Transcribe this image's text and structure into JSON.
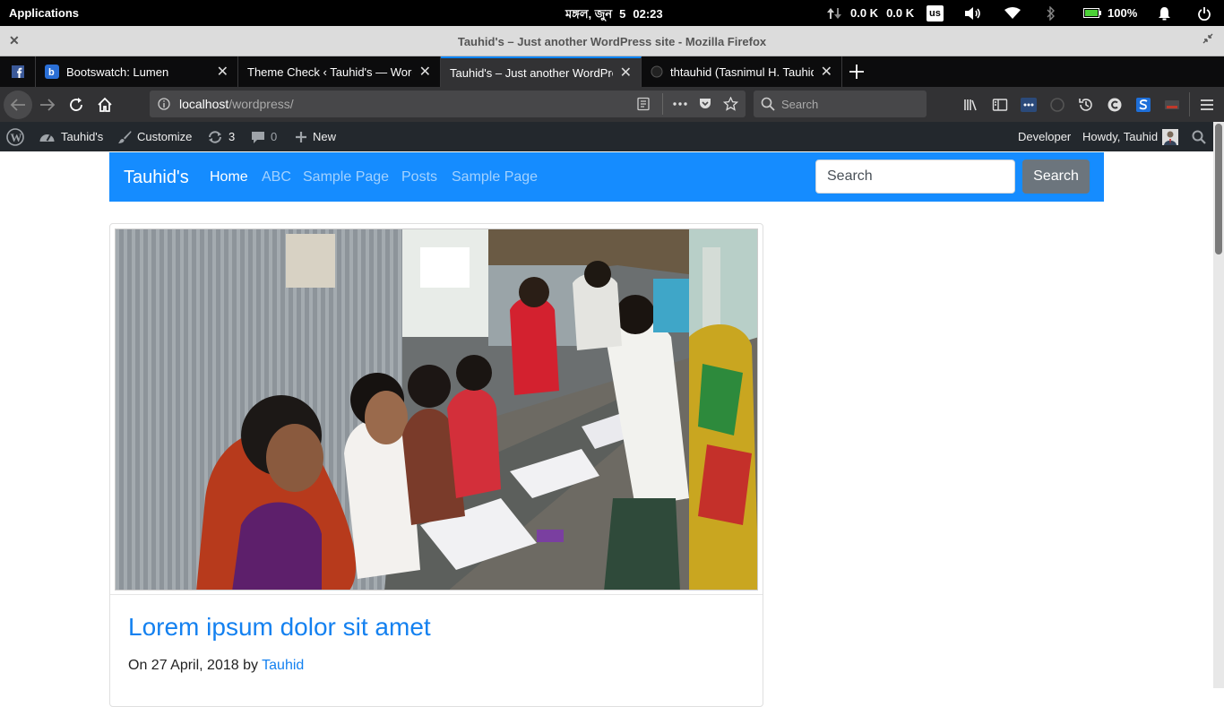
{
  "topbar": {
    "applications": "Applications",
    "date": "মঙ্গল, জুন",
    "day": "5",
    "time": "02:23",
    "net_up": "0.0 K",
    "net_down": "0.0 K",
    "keyboard": "us",
    "battery": "100%"
  },
  "window": {
    "title": "Tauhid's – Just another WordPress site - Mozilla Firefox"
  },
  "tabs": [
    {
      "label": "Bootswatch: Lumen",
      "icon": "bootswatch-icon"
    },
    {
      "label": "Theme Check ‹ Tauhid's — WordPress",
      "icon": "wordpress-icon"
    },
    {
      "label": "Tauhid's – Just another WordPress site",
      "icon": "page-icon",
      "active": true
    },
    {
      "label": "thtauhid (Tasnimul H. Tauhid)",
      "icon": "github-icon"
    }
  ],
  "navbar": {
    "url_host": "localhost",
    "url_path": "/wordpress/",
    "search_placeholder": "Search"
  },
  "wpbar": {
    "site": "Tauhid's",
    "customize": "Customize",
    "updates": "3",
    "comments": "0",
    "new": "New",
    "developer": "Developer",
    "howdy": "Howdy, Tauhid"
  },
  "site": {
    "brand": "Tauhid's",
    "nav": [
      "Home",
      "ABC",
      "Sample Page",
      "Posts",
      "Sample Page"
    ],
    "search_placeholder": "Search",
    "search_button": "Search"
  },
  "post": {
    "title": "Lorem ipsum dolor sit amet",
    "meta_prefix": "On 27 April, 2018 by",
    "author": "Tauhid"
  },
  "colors": {
    "navbar_blue": "#158cff",
    "link_blue": "#1481f0",
    "tab_active_accent": "#0a84ff"
  }
}
